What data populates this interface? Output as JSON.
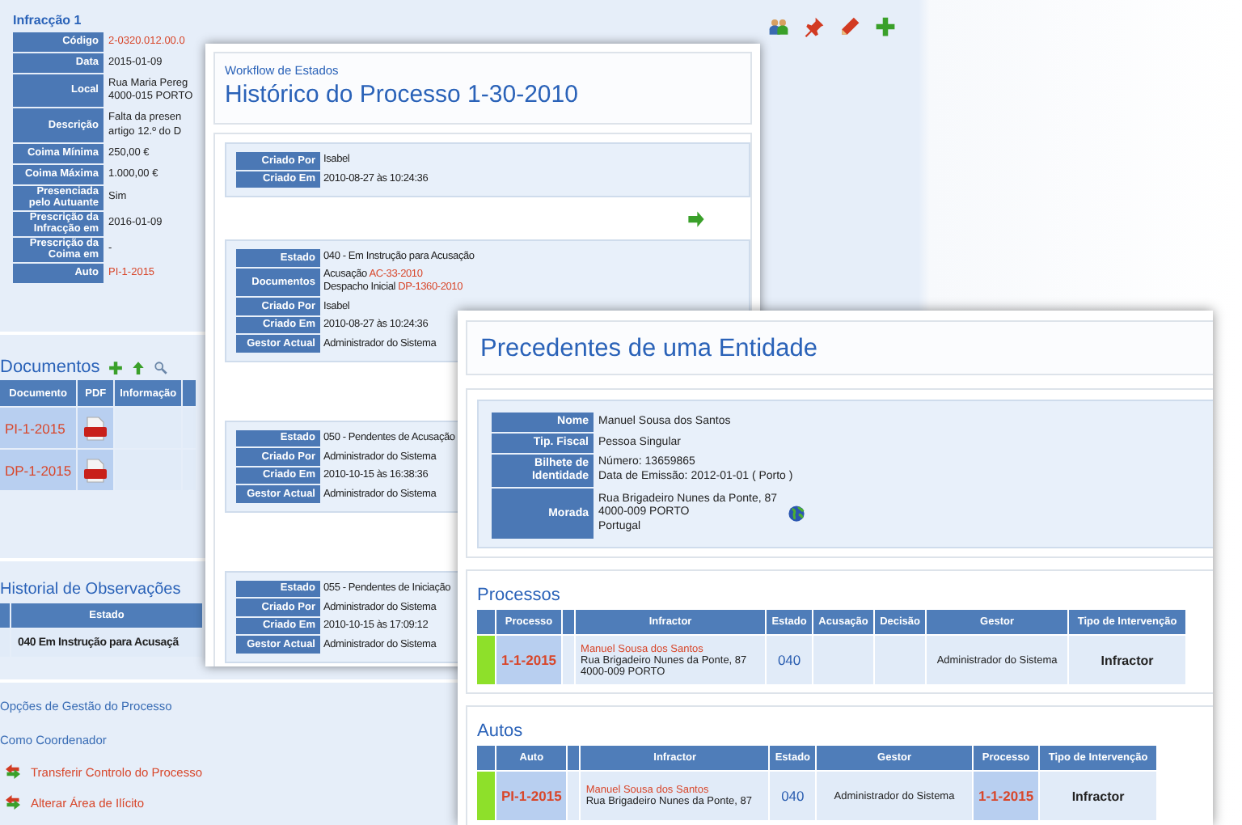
{
  "case_page": {
    "section_title": "Infracção 1",
    "fields": [
      {
        "label": "Código",
        "lines": [
          {
            "link": "2-0320.012.00.0"
          }
        ]
      },
      {
        "label": "Data",
        "lines": [
          "2015-01-09"
        ]
      },
      {
        "label": "Local",
        "lines": [
          "Rua Maria Pereg",
          "4000-015 PORTO"
        ]
      },
      {
        "label": "Descrição",
        "lines": [
          "Falta da presen",
          "artigo 12.º do D"
        ]
      },
      {
        "label": "Coima Mínima",
        "lines": [
          "250,00 €"
        ]
      },
      {
        "label": "Coima Máxima",
        "lines": [
          "1.000,00 €"
        ]
      },
      {
        "label": "Presenciada pelo Autuante",
        "lines": [
          "Sim"
        ]
      },
      {
        "label": "Prescrição da Infracção em",
        "lines": [
          "2016-01-09"
        ]
      },
      {
        "label": "Prescrição da Coima em",
        "lines": [
          "-"
        ]
      },
      {
        "label": "Auto",
        "lines": [
          {
            "link": "PI-1-2015"
          }
        ]
      }
    ],
    "documents": {
      "title": "Documentos",
      "columns": [
        "Documento",
        "PDF",
        "Informação"
      ],
      "rows": [
        {
          "document": "PI-1-2015"
        },
        {
          "document": "DP-1-2015"
        }
      ]
    },
    "observations": {
      "title": "Historial de Observações",
      "columns": [
        "Estado"
      ],
      "rows": [
        {
          "state": "040 Em Instrução para Acusaçã"
        }
      ]
    },
    "options": {
      "title": "Opções de Gestão do Processo",
      "subtitle": "Como Coordenador",
      "actions": [
        "Transferir Controlo do Processo",
        "Alterar Área de Ilícito"
      ]
    }
  },
  "workflow_window": {
    "subtitle": "Workflow de Estados",
    "title": "Histórico do Processo 1-30-2010",
    "entries": [
      {
        "fields": [
          {
            "label": "Criado Por",
            "lines": [
              "Isabel"
            ]
          },
          {
            "label": "Criado Em",
            "lines": [
              "2010-08-27 às 10:24:36"
            ]
          }
        ]
      },
      {
        "fields": [
          {
            "label": "Estado",
            "lines": [
              "040 - Em Instrução para Acusação"
            ]
          },
          {
            "label": "Documentos",
            "lines": [
              {
                "text": "Acusação",
                "link": "AC-33-2010"
              },
              {
                "text": "Despacho Inicial",
                "link": "DP-1360-2010"
              }
            ]
          },
          {
            "label": "Criado Por",
            "lines": [
              "Isabel"
            ]
          },
          {
            "label": "Criado Em",
            "lines": [
              "2010-08-27 às 10:24:36"
            ]
          },
          {
            "label": "Gestor Actual",
            "lines": [
              "Administrador do Sistema"
            ]
          }
        ]
      },
      {
        "fields": [
          {
            "label": "Estado",
            "lines": [
              "050 - Pendentes de Acusação"
            ]
          },
          {
            "label": "Criado Por",
            "lines": [
              "Administrador do Sistema"
            ]
          },
          {
            "label": "Criado Em",
            "lines": [
              "2010-10-15 às 16:38:36"
            ]
          },
          {
            "label": "Gestor Actual",
            "lines": [
              "Administrador do Sistema"
            ]
          }
        ]
      },
      {
        "fields": [
          {
            "label": "Estado",
            "lines": [
              "055 - Pendentes de Iniciação"
            ]
          },
          {
            "label": "Criado Por",
            "lines": [
              "Administrador do Sistema"
            ]
          },
          {
            "label": "Criado Em",
            "lines": [
              "2010-10-15 às 17:09:12"
            ]
          },
          {
            "label": "Gestor Actual",
            "lines": [
              "Administrador do Sistema"
            ]
          }
        ]
      }
    ]
  },
  "entity_window": {
    "title": "Precedentes de uma Entidade",
    "fields": [
      {
        "label": "Nome",
        "lines": [
          "Manuel Sousa dos Santos"
        ]
      },
      {
        "label": "Tip. Fiscal",
        "lines": [
          "Pessoa Singular"
        ]
      },
      {
        "label": "Bilhete de Identidade",
        "lines": [
          "Número: 13659865",
          "Data de Emissão: 2012-01-01  ( Porto )"
        ]
      },
      {
        "label": "Morada",
        "lines": [
          "Rua Brigadeiro Nunes da Ponte, 87",
          "4000-009 PORTO",
          "Portugal"
        ],
        "map": true
      }
    ],
    "processes": {
      "title": "Processos",
      "columns": [
        "Processo",
        "Infractor",
        "Estado",
        "Acusação",
        "Decisão",
        "Gestor",
        "Tipo de Intervenção"
      ],
      "rows": [
        {
          "color": "#8ee02a",
          "cells": [
            {
              "kind": "link",
              "text": "1-1-2015"
            },
            {
              "kind": "person",
              "name": "Manuel Sousa dos Santos",
              "address": [
                "Rua Brigadeiro Nunes da Ponte, 87",
                "4000-009 PORTO"
              ]
            },
            {
              "kind": "code",
              "text": "040"
            },
            {
              "kind": "blank"
            },
            {
              "kind": "blank"
            },
            {
              "kind": "text",
              "text": "Administrador do Sistema"
            },
            {
              "kind": "bold",
              "text": "Infractor"
            }
          ]
        }
      ]
    },
    "records": {
      "title": "Autos",
      "columns": [
        "Auto",
        "Infractor",
        "Estado",
        "Gestor",
        "Processo",
        "Tipo de Intervenção"
      ],
      "rows": [
        {
          "color": "#8ee02a",
          "cells": [
            {
              "kind": "link",
              "text": "PI-1-2015"
            },
            {
              "kind": "person",
              "name": "Manuel Sousa dos Santos",
              "address": [
                "Rua Brigadeiro Nunes da Ponte, 87"
              ]
            },
            {
              "kind": "code",
              "text": "040"
            },
            {
              "kind": "text",
              "text": "Administrador do Sistema"
            },
            {
              "kind": "link",
              "text": "1-1-2015"
            },
            {
              "kind": "bold",
              "text": "Infractor"
            }
          ]
        }
      ]
    }
  }
}
